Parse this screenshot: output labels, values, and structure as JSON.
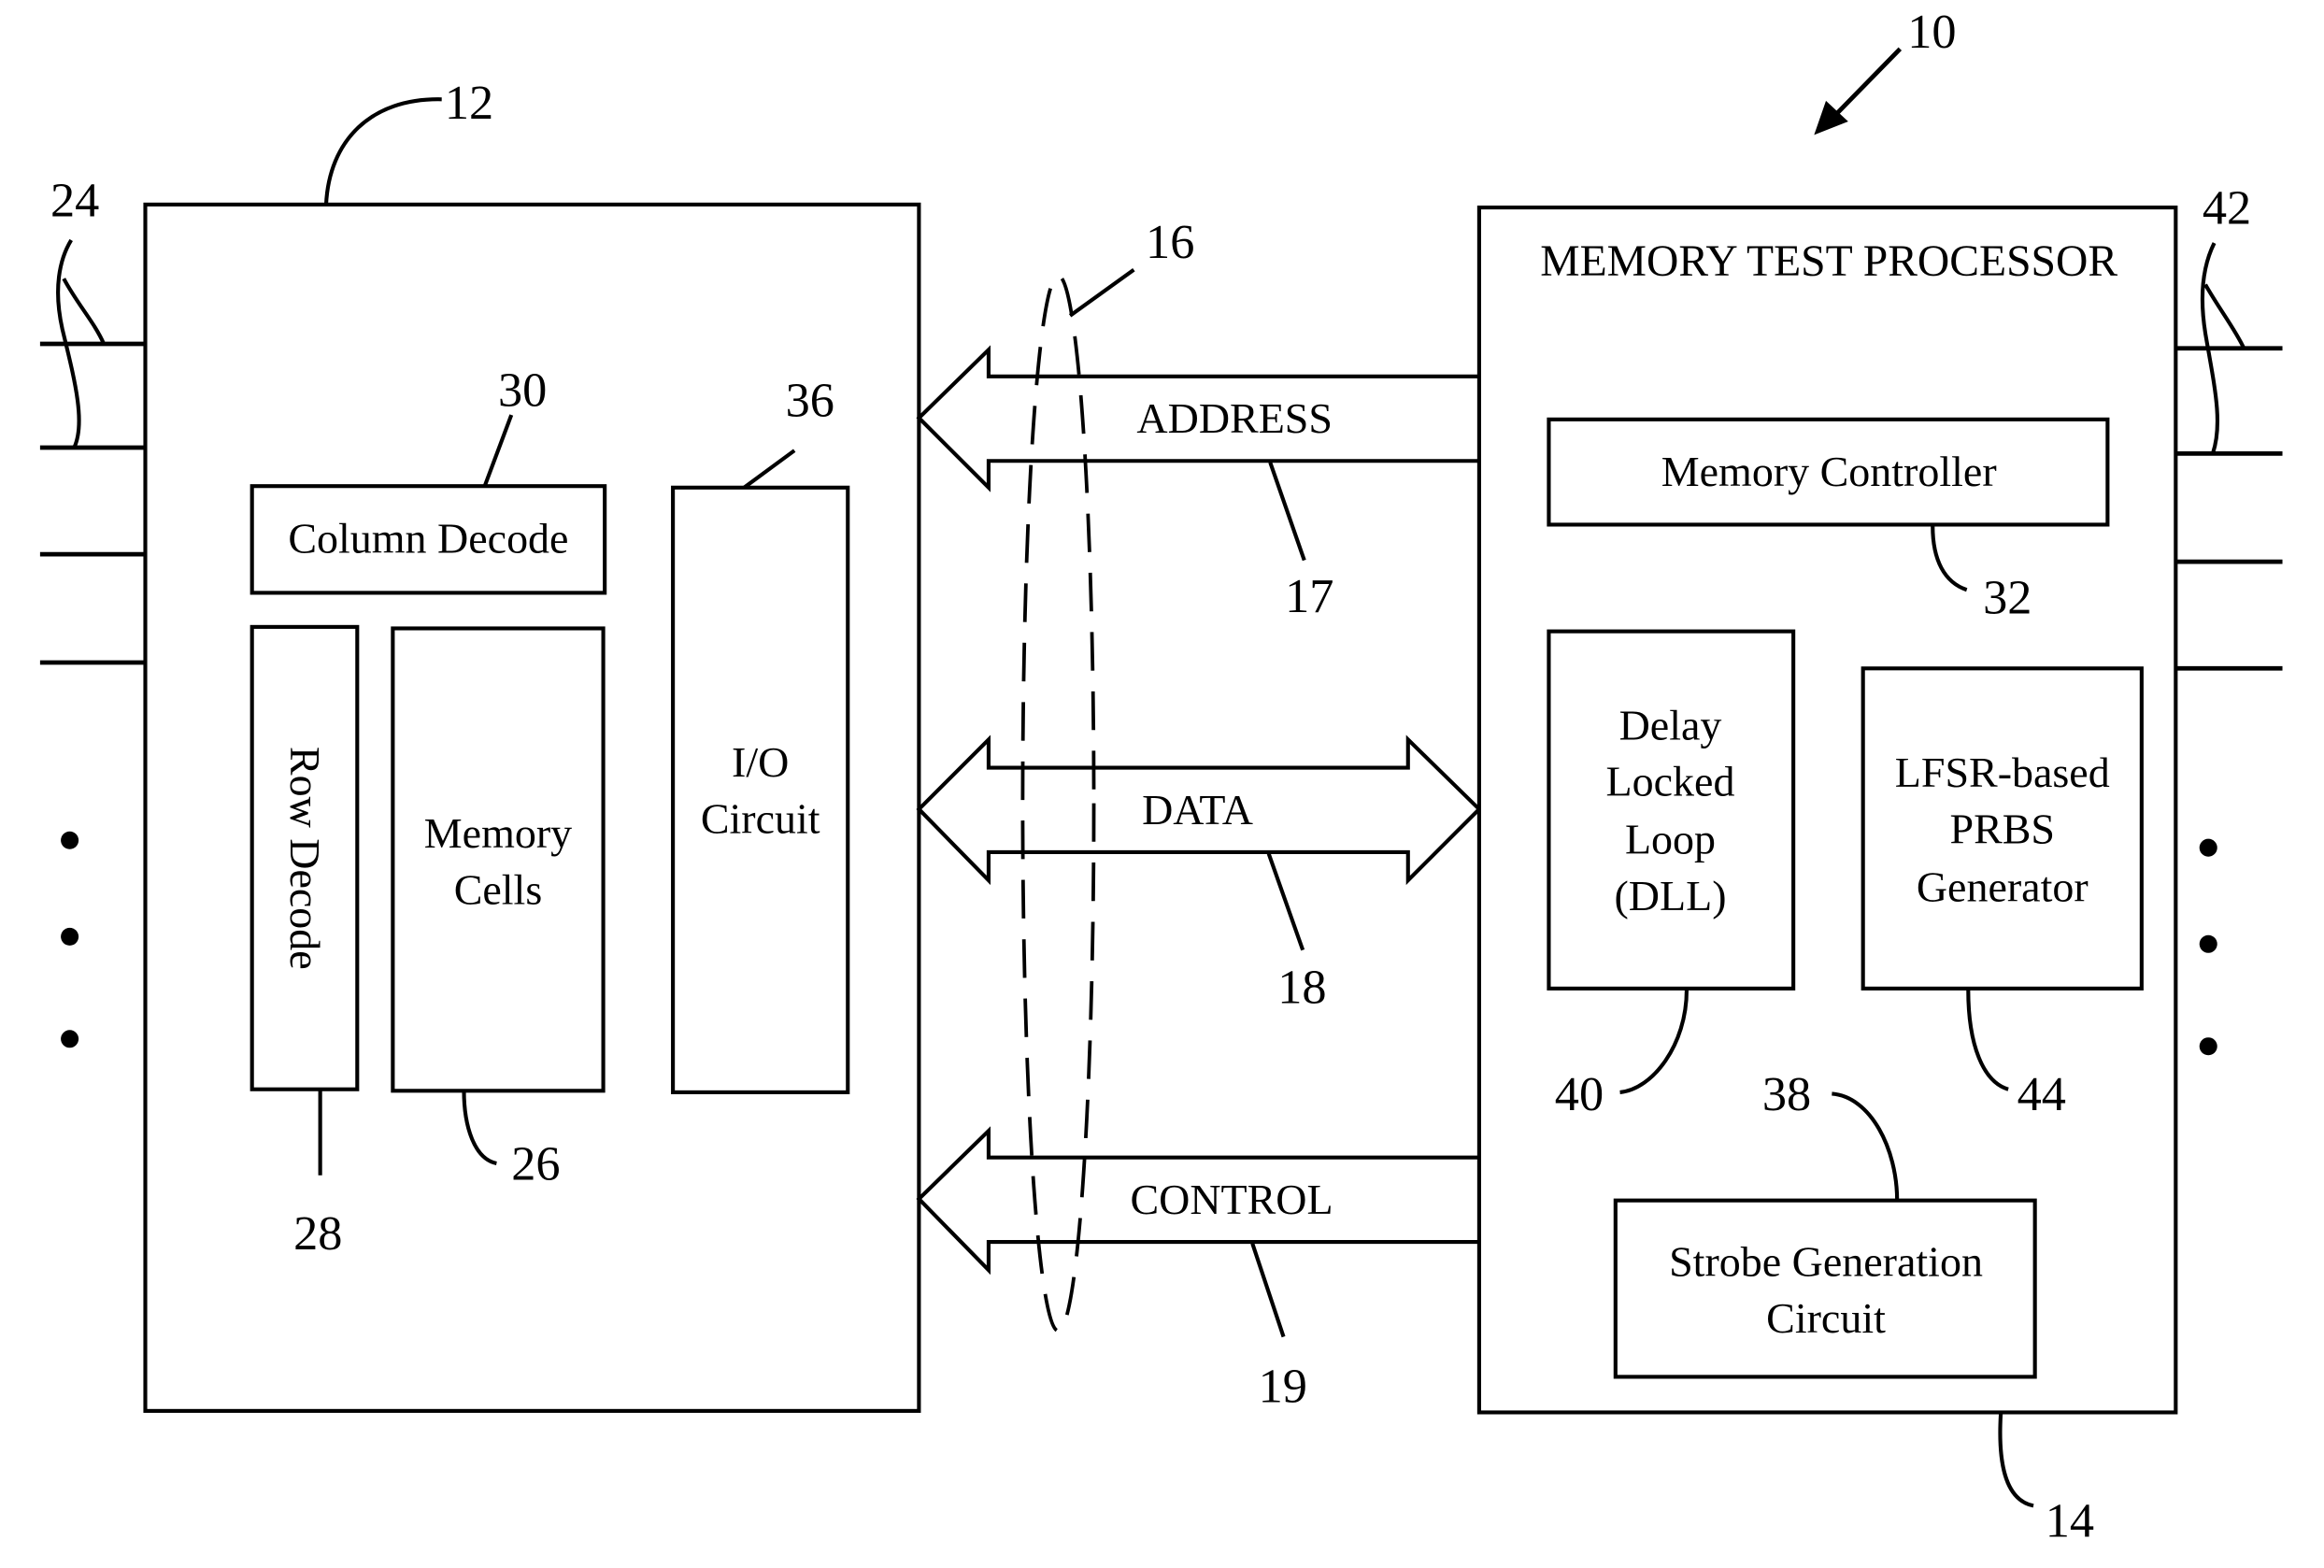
{
  "figure": {
    "system_ref": "10",
    "memory_device": {
      "ref": "12",
      "leads_ref": "24",
      "blocks": {
        "column_decode": {
          "label": "Column Decode",
          "ref": "30"
        },
        "row_decode": {
          "label": "Row Decode",
          "ref": "28"
        },
        "memory_cells": {
          "label_lines": [
            "Memory",
            "Cells"
          ],
          "ref": "26"
        },
        "io_circuit": {
          "label_lines": [
            "I/O",
            "Circuit"
          ],
          "ref": "36"
        }
      }
    },
    "bus": {
      "ref": "16",
      "address": {
        "label": "ADDRESS",
        "ref": "17"
      },
      "data": {
        "label": "DATA",
        "ref": "18"
      },
      "control": {
        "label": "CONTROL",
        "ref": "19"
      }
    },
    "processor": {
      "ref": "14",
      "title": "MEMORY TEST PROCESSOR",
      "leads_ref": "42",
      "blocks": {
        "memory_controller": {
          "label": "Memory Controller",
          "ref": "32"
        },
        "dll": {
          "label_lines": [
            "Delay",
            "Locked",
            "Loop",
            "(DLL)"
          ],
          "ref": "40"
        },
        "lfsr": {
          "label_lines": [
            "LFSR-based",
            "PRBS",
            "Generator"
          ],
          "ref": "44"
        },
        "strobe": {
          "label_lines": [
            "Strobe Generation",
            "Circuit"
          ],
          "ref": "38"
        }
      }
    },
    "colors": {
      "stroke": "#000000",
      "background": "#ffffff"
    }
  }
}
